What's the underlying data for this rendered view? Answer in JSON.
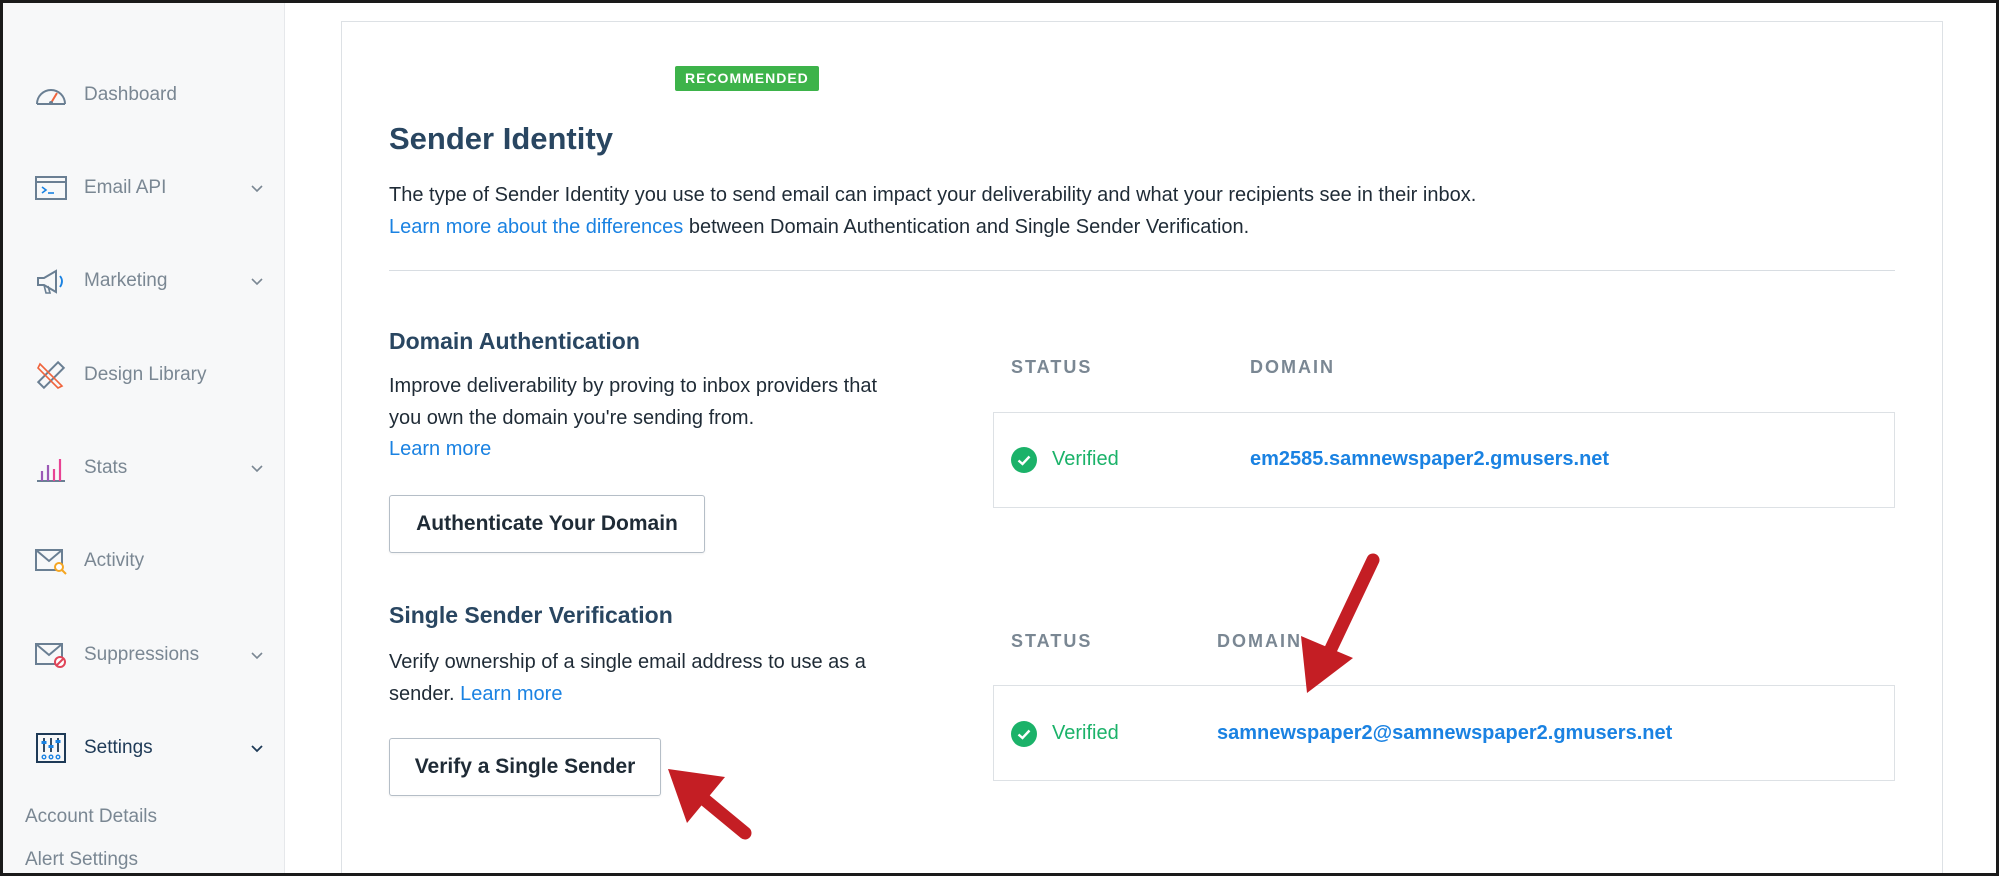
{
  "sidebar": {
    "items": [
      {
        "label": "Dashboard",
        "icon": "dashboard-gauge-icon"
      },
      {
        "label": "Email API",
        "icon": "terminal-window-icon"
      },
      {
        "label": "Marketing",
        "icon": "megaphone-icon"
      },
      {
        "label": "Design Library",
        "icon": "pencil-ruler-icon"
      },
      {
        "label": "Stats",
        "icon": "bar-stats-icon"
      },
      {
        "label": "Activity",
        "icon": "envelope-search-icon"
      },
      {
        "label": "Suppressions",
        "icon": "envelope-block-icon"
      },
      {
        "label": "Settings",
        "icon": "sliders-icon"
      }
    ],
    "subitems": [
      {
        "label": "Account Details"
      },
      {
        "label": "Alert Settings"
      }
    ]
  },
  "main": {
    "badge": "RECOMMENDED",
    "title": "Sender Identity",
    "description_line1": "The type of Sender Identity you use to send email can impact your deliverability and what your recipients see in their inbox.",
    "description_link": "Learn more about the differences",
    "description_line2": " between Domain Authentication and Single Sender Verification.",
    "domain_auth": {
      "heading": "Domain Authentication",
      "text": "Improve deliverability by proving to inbox providers that you own the domain you're sending from.",
      "link": "Learn more",
      "button": "Authenticate Your Domain",
      "status_header": "STATUS",
      "domain_header": "DOMAIN",
      "status": "Verified",
      "domain": "em2585.samnewspaper2.gmusers.net"
    },
    "single_sender": {
      "heading": "Single Sender Verification",
      "text": "Verify ownership of a single email address to use as a sender. ",
      "link": "Learn more",
      "button": "Verify a Single Sender",
      "status_header": "STATUS",
      "domain_header": "DOMAIN",
      "status": "Verified",
      "domain": "samnewspaper2@samnewspaper2.gmusers.net"
    }
  },
  "colors": {
    "accent_link": "#1a82e2",
    "verified_green": "#1bb269",
    "badge_green": "#3db34a",
    "annotation_arrow": "#c41e24",
    "heading": "#294661"
  }
}
